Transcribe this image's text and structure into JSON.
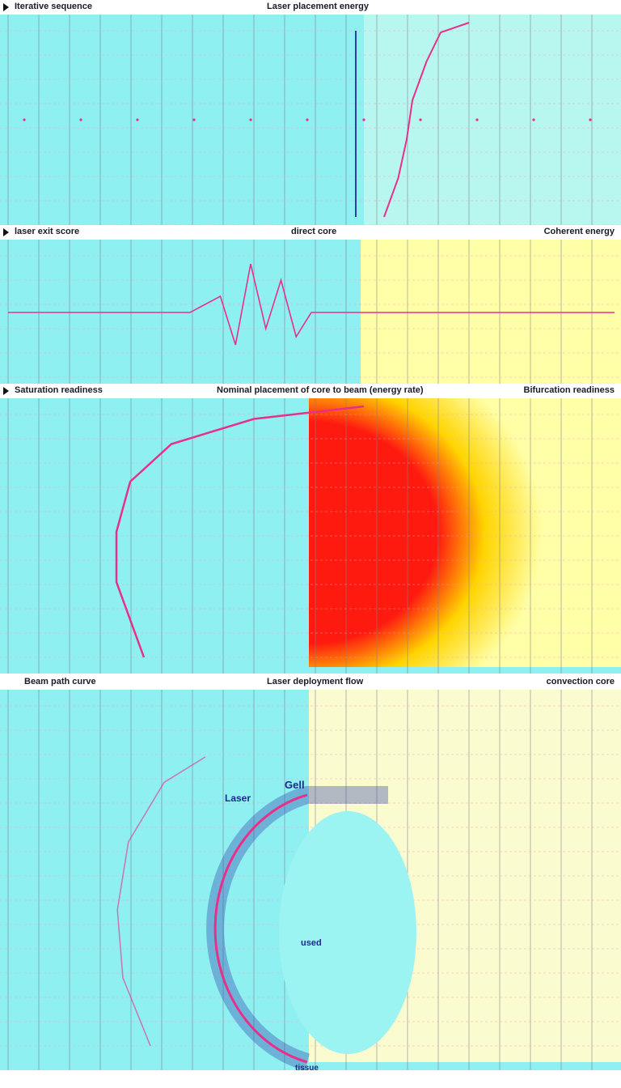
{
  "panels": [
    {
      "left_title": "Iterative sequence",
      "center_title": "Laser placement energy",
      "right_title": ""
    },
    {
      "left_title": "laser exit score",
      "center_title": "direct core",
      "right_title": "Coherent energy"
    },
    {
      "left_title": "Saturation readiness",
      "center_title": "Nominal placement of core to beam (energy rate)",
      "right_title": "Bifurcation readiness"
    },
    {
      "left_title": "Beam path curve",
      "center_title": "Laser deployment flow",
      "right_title": "convection core"
    }
  ],
  "labels": {
    "laser": "Laser",
    "gel": "Gell",
    "inner": "used",
    "tissue": "tissue"
  },
  "chart_data": [
    {
      "type": "scatter",
      "series": [
        {
          "values": [
            [
              -100,
              0
            ],
            [
              -80,
              0
            ],
            [
              -60,
              0
            ],
            [
              -40,
              0
            ],
            [
              -20,
              0
            ],
            [
              0,
              0
            ],
            [
              20,
              0
            ],
            [
              40,
              0
            ],
            [
              60,
              0
            ],
            [
              80,
              0
            ],
            [
              100,
              0
            ]
          ]
        },
        {
          "values": [
            [
              -30,
              -100
            ],
            [
              -25,
              -60
            ],
            [
              -22,
              -20
            ],
            [
              -20,
              20
            ],
            [
              -15,
              60
            ],
            [
              -10,
              90
            ],
            [
              0,
              100
            ]
          ]
        }
      ]
    },
    {
      "type": "line",
      "series": [
        {
          "values": [
            [
              -100,
              0
            ],
            [
              -40,
              0
            ],
            [
              -30,
              10
            ],
            [
              -25,
              -20
            ],
            [
              -20,
              30
            ],
            [
              -15,
              -10
            ],
            [
              -10,
              20
            ],
            [
              -5,
              -15
            ],
            [
              0,
              0
            ],
            [
              20,
              0
            ],
            [
              100,
              0
            ]
          ]
        }
      ]
    },
    {
      "type": "heatmap",
      "series": [
        {
          "values": [
            [
              -80,
              -100
            ],
            [
              -90,
              -40
            ],
            [
              -90,
              0
            ],
            [
              -85,
              40
            ],
            [
              -70,
              70
            ],
            [
              -40,
              90
            ],
            [
              0,
              100
            ]
          ]
        }
      ]
    },
    {
      "type": "scatter",
      "series": [
        {
          "values": [
            [
              -60,
              -100
            ],
            [
              -70,
              -60
            ],
            [
              -72,
              -20
            ],
            [
              -68,
              20
            ],
            [
              -55,
              55
            ],
            [
              -40,
              70
            ]
          ]
        }
      ]
    }
  ],
  "colors": {
    "background": "#8ff0f2",
    "grid_major": "#7a7f8c",
    "grid_minor": "#ff9db0",
    "series_magenta": "#e8308a",
    "series_blue": "#2b3fa8",
    "heat_hot": "#ff1a10",
    "heat_warm": "#ffd400",
    "heat_cool": "#ffffa8"
  }
}
